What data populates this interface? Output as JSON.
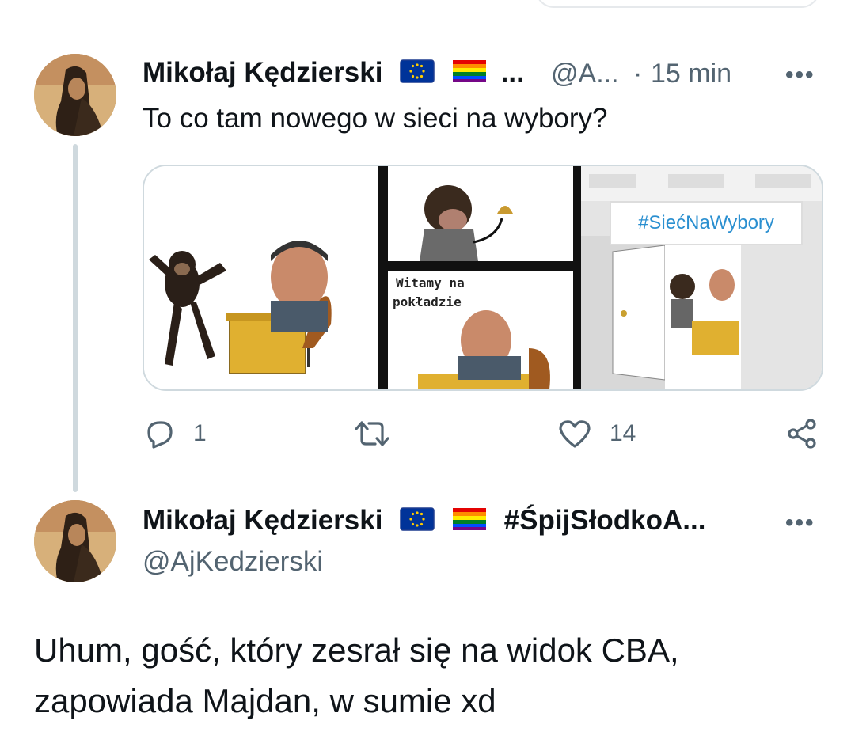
{
  "tweet1": {
    "author_name": "Mikołaj Kędzierski",
    "name_tail": "...",
    "handle_truncated": "@A...",
    "separator": "·",
    "time": "15 min",
    "text": "To co tam nowego w sieci na wybory?",
    "media": {
      "comic_caption_line1": "Witamy na",
      "comic_caption_line2": "pokładzie",
      "sign_text": "#SiećNaWybory"
    },
    "actions": {
      "reply_count": "1",
      "retweet_count": "",
      "like_count": "14"
    }
  },
  "tweet2": {
    "author_name": "Mikołaj Kędzierski",
    "display_tag": "#ŚpijSłodkoA...",
    "handle": "@AjKedzierski",
    "text": "Uhum, gość, który zesrał się na widok CBA, zapowiada Majdan, w sumie xd"
  },
  "more_label": "•••",
  "icons": [
    "eu-flag-icon",
    "rainbow-flag-icon",
    "reply-icon",
    "retweet-icon",
    "like-icon",
    "share-icon",
    "more-icon"
  ],
  "colors": {
    "text": "#0f1419",
    "secondary": "#536471",
    "thread_line": "#cfd9de",
    "eu_blue": "#003399",
    "eu_star": "#ffcc00"
  }
}
